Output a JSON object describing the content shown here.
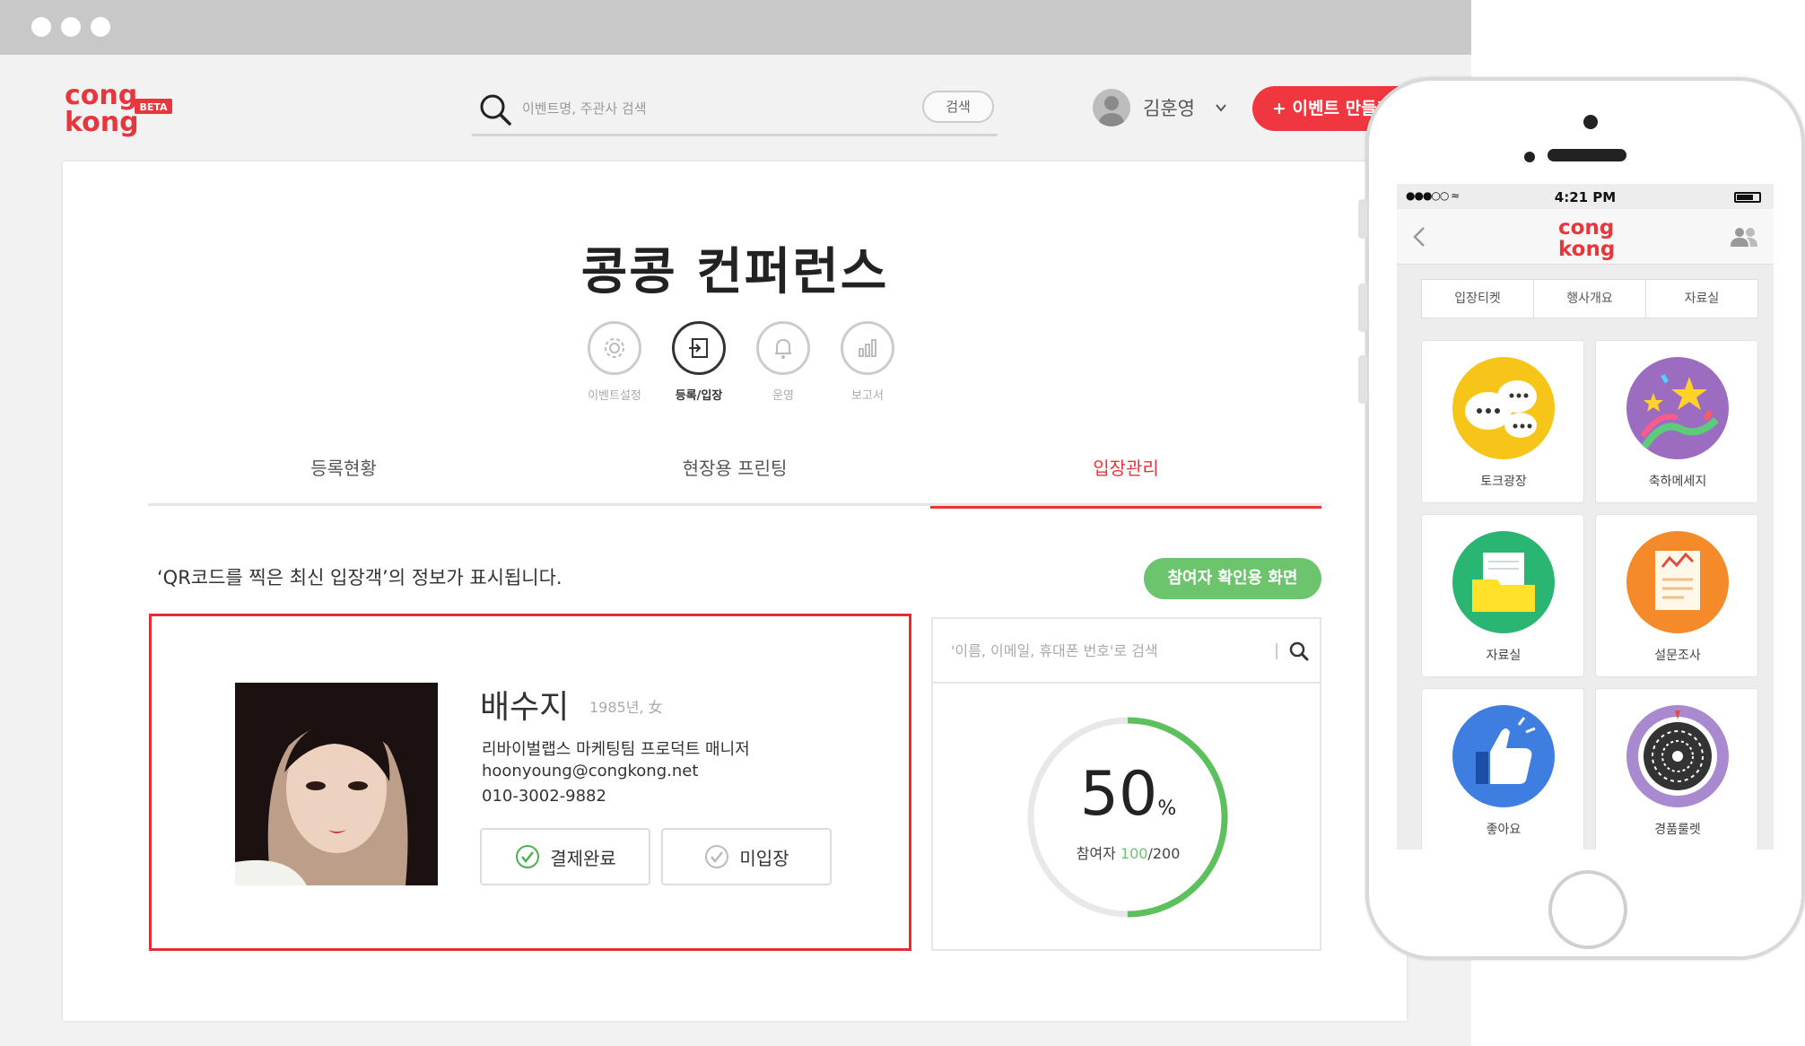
{
  "brand": {
    "logo_line1": "cong",
    "logo_line2": "kong",
    "beta": "BETA",
    "accent": "#f0373f",
    "green": "#6cc56c"
  },
  "header": {
    "search_placeholder": "이벤트명, 주관사 검색",
    "search_button": "검색",
    "user_name": "김훈영",
    "create_button": "+ 이벤트 만들기"
  },
  "event": {
    "title": "콩콩 컨퍼런스",
    "nav": [
      {
        "label": "이벤트설정",
        "icon": "gear-icon"
      },
      {
        "label": "등록/입장",
        "icon": "entry-icon"
      },
      {
        "label": "운영",
        "icon": "bell-icon"
      },
      {
        "label": "보고서",
        "icon": "bar-chart-icon"
      }
    ],
    "tabs": [
      {
        "label": "등록현황"
      },
      {
        "label": "현장용 프린팅"
      },
      {
        "label": "입장관리"
      }
    ]
  },
  "entry": {
    "info_text": "‘QR코드를 찍은 최신 입장객’의 정보가 표시됩니다.",
    "confirm_button": "참여자 확인용 화면",
    "guest": {
      "name": "배수지",
      "meta": "1985년, 女",
      "org": "리바이벌랩스 마케팅팀 프로덕트 매니저",
      "email": "hoonyoung@congkong.net",
      "phone": "010-3002-9882",
      "paid_label": "결제완료",
      "not_entered_label": "미입장"
    },
    "stats": {
      "search_placeholder": "'이름, 이메일, 휴대폰 번호'로 검색",
      "percent": "50",
      "percent_unit": "%",
      "participants_label": "참여자",
      "entered": "100",
      "total": "/200",
      "progress": 0.5
    }
  },
  "phone": {
    "time": "4:21 PM",
    "segments": [
      "입장티켓",
      "행사개요",
      "자료실"
    ],
    "tiles": [
      {
        "label": "토크광장",
        "icon": "talk-icon",
        "color": "#f7c518"
      },
      {
        "label": "축하메세지",
        "icon": "celebration-icon",
        "color": "#9b6cc0"
      },
      {
        "label": "자료실",
        "icon": "folder-icon",
        "color": "#2bb573"
      },
      {
        "label": "설문조사",
        "icon": "survey-icon",
        "color": "#f58a2a"
      },
      {
        "label": "좋아요",
        "icon": "thumbs-up-icon",
        "color": "#3d7ee0"
      },
      {
        "label": "경품룰렛",
        "icon": "roulette-icon",
        "color": "#a98ad0"
      }
    ]
  }
}
